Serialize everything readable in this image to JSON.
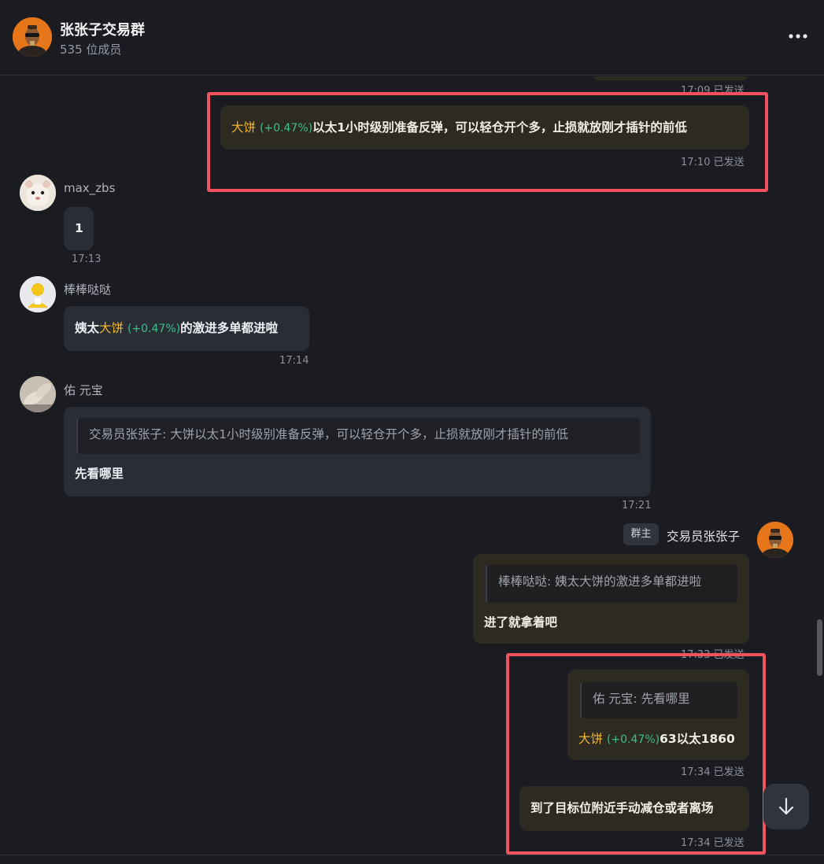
{
  "header": {
    "title": "张张子交易群",
    "members": "535 位成员",
    "more_icon": "more-horizontal-icon"
  },
  "colors": {
    "background": "#1b1c21",
    "my_bubble": "#2d2a21",
    "their_bubble": "#282d36",
    "token_name": "#f4b730",
    "price_change": "#3cbf86",
    "highlight_box": "#f0535d"
  },
  "messages": {
    "prev_time": "17:09 已发送",
    "m1": {
      "token": "大饼",
      "change": "(+0.47%)",
      "text": "以太1小时级别准备反弹，可以轻仓开个多，止损就放刚才插针的前低",
      "time": "17:10 已发送"
    },
    "m2": {
      "user": "max_zbs",
      "text": "1",
      "time": "17:13"
    },
    "m3": {
      "user": "棒棒哒哒",
      "prefix": "姨太",
      "token": "大饼",
      "change": "(+0.47%)",
      "suffix": "的激进多单都进啦",
      "time": "17:14"
    },
    "m4": {
      "user": "佑 元宝",
      "quote": "交易员张张子: 大饼以太1小时级别准备反弹，可以轻仓开个多，止损就放刚才插针的前低",
      "text": "先看哪里",
      "time": "17:21"
    },
    "m5": {
      "role": "群主",
      "user": "交易员张张子",
      "quote": "棒棒哒哒: 姨太大饼的激进多单都进啦",
      "text": "进了就拿着吧",
      "time": "17:33 已发送"
    },
    "m6": {
      "quote": "佑 元宝: 先看哪里",
      "token": "大饼",
      "change": "(+0.47%)",
      "suffix": "63以太1860",
      "time": "17:34 已发送"
    },
    "m7": {
      "text": "到了目标位附近手动减仓或者离场",
      "time": "17:34 已发送"
    }
  },
  "scroll_down_icon": "arrow-down-icon"
}
